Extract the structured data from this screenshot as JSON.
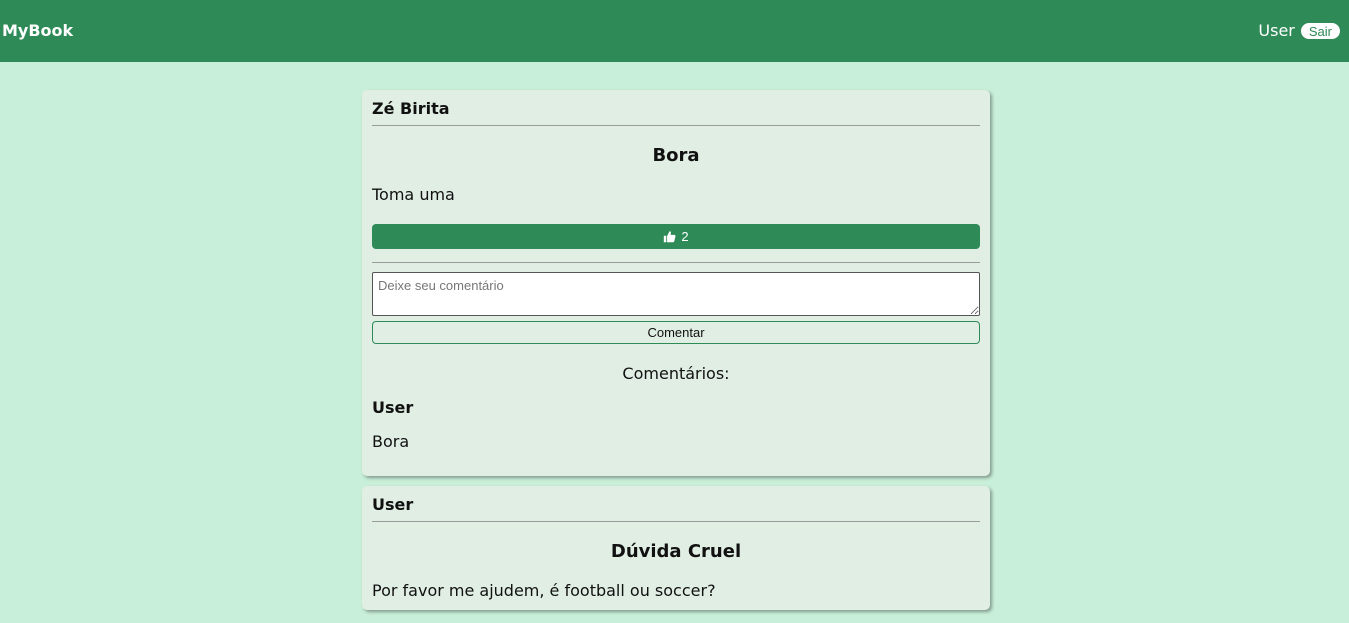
{
  "navbar": {
    "brand": "MyBook",
    "user": "User",
    "logout_label": "Sair"
  },
  "posts": [
    {
      "author": "Zé Birita",
      "title": "Bora",
      "body": "Toma uma",
      "likes": "2",
      "comment_placeholder": "Deixe seu comentário",
      "comment_button": "Comentar",
      "comments_heading": "Comentários:",
      "comments": [
        {
          "author": "User",
          "text": "Bora"
        }
      ]
    },
    {
      "author": "User",
      "title": "Dúvida Cruel",
      "body": "Por favor me ajudem, é football ou soccer?"
    }
  ],
  "icons": {
    "like": "thumbs-up-icon"
  },
  "colors": {
    "navbar": "#2e8b57",
    "background": "#c8efd9",
    "card": "#e0eee4",
    "accent": "#2e8b57"
  }
}
